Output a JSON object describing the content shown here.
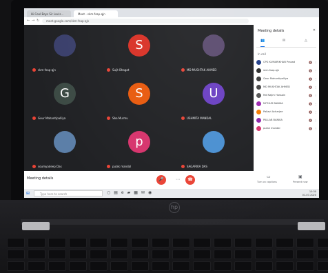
{
  "browser": {
    "tabs": [
      {
        "label": "Hi Cool Boys Sir Lau's..."
      },
      {
        "label": "Meet - skm-fsap-qjn"
      }
    ],
    "url": "meet.google.com/skm-fsap-qjn"
  },
  "meeting": {
    "tiles": [
      {
        "name": "skm-fsap-qjn",
        "kind": "photo",
        "color": "#3a3f6b"
      },
      {
        "name": "Sujit Bhagat",
        "kind": "letter",
        "letter": "S",
        "color": "#d93025"
      },
      {
        "name": "MD MUSHTAK AHMED",
        "kind": "photo",
        "color": "#5a4a6e"
      },
      {
        "name": "Gour Mahantipalliya",
        "kind": "letter",
        "letter": "G",
        "color": "#3c4a44"
      },
      {
        "name": "Sba Murmu",
        "kind": "letter",
        "letter": "S",
        "color": "#e8590c"
      },
      {
        "name": "USHMITA MANDAL",
        "kind": "letter",
        "letter": "U",
        "color": "#6a3fc2"
      },
      {
        "name": "soumyadeep Das",
        "kind": "photo",
        "color": "#5c7fa8"
      },
      {
        "name": "pulak mandal",
        "kind": "letter",
        "letter": "p",
        "color": "#d6336c"
      },
      {
        "name": "SAGARIKA DAS",
        "kind": "photo",
        "color": "#4a8fd1"
      }
    ]
  },
  "sidebar": {
    "title": "Meeting details",
    "section_label": "In call",
    "participants": [
      {
        "name": "CPG KUMARIKHAN Prasad",
        "color": "#1f3c88"
      },
      {
        "name": "skm-fsap-qjn",
        "color": "#2b2b2b"
      },
      {
        "name": "Gour Mahantipalliya",
        "color": "#3a3a3a"
      },
      {
        "name": "MD MUSHTAK AHMED",
        "color": "#444444"
      },
      {
        "name": "Md Najim Hossain",
        "color": "#555555"
      },
      {
        "name": "MITHUR BANIKA",
        "color": "#9c27b0"
      },
      {
        "name": "Pallavi Acharjee",
        "color": "#f57c00"
      },
      {
        "name": "PALLAB BANIKA",
        "color": "#8e24aa"
      },
      {
        "name": "pulak mandal",
        "color": "#d6336c"
      }
    ]
  },
  "controls": {
    "meeting_details_label": "Meeting details",
    "captions_label": "Turn on captions",
    "present_label": "Present now"
  },
  "taskbar": {
    "search_placeholder": "Type here to search",
    "time": "10:30",
    "date": "01-07-2020"
  },
  "icons": [
    "windows-logo-icon",
    "mic-off-icon",
    "hang-up-icon",
    "more-options-icon",
    "people-icon",
    "chat-icon",
    "activities-icon",
    "hp-logo-icon"
  ]
}
